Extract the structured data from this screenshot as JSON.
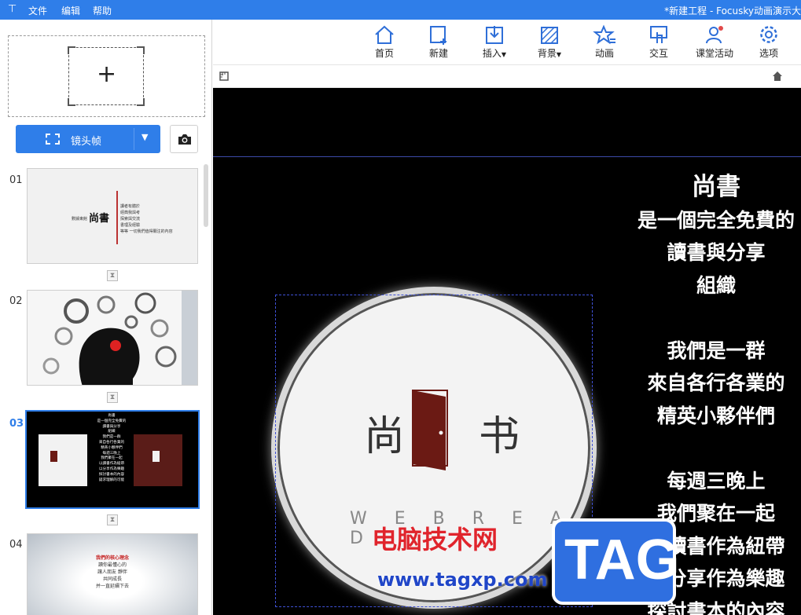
{
  "titlebar": {
    "pin_icon": "pin-icon",
    "menu": [
      "文件",
      "编辑",
      "帮助"
    ],
    "window_title": "*新建工程 - Focusky动画演示大"
  },
  "sidebar": {
    "lens_button_label": "镜头帧",
    "slides": [
      {
        "num": "01",
        "lines": [
          "尚書",
          "數據東館",
          "讀者有體於",
          "經典我與考",
          "探索與交流",
          "書理及經驗",
          "等等 一切我們值得關注的內容"
        ]
      },
      {
        "num": "02"
      },
      {
        "num": "03",
        "lines": [
          "尚書",
          "是一個完全免費的",
          "讀書與分享",
          "組織",
          "我們是一群",
          "來自各行各業的",
          "精英小夥伴們",
          "每週三晚上",
          "我們聚在一起",
          "以讀書作為紐帶",
          "以分享作為樂趣",
          "探討書本的內容",
          "疑求理解的可能"
        ]
      },
      {
        "num": "04",
        "lines": [
          "我們的核心理念",
          "讀你最懂心的",
          "讓人朋友 靜伴",
          "共同成長",
          "并一直延續下去"
        ]
      }
    ]
  },
  "toolbar": {
    "items": [
      {
        "label": "首页",
        "icon": "home-icon"
      },
      {
        "label": "新建",
        "icon": "new-slide-icon"
      },
      {
        "label": "插入",
        "icon": "insert-icon",
        "dropdown": true
      },
      {
        "label": "背景",
        "icon": "background-icon",
        "dropdown": true
      },
      {
        "label": "动画",
        "icon": "animation-icon"
      },
      {
        "label": "交互",
        "icon": "interaction-icon"
      },
      {
        "label": "课堂活动",
        "icon": "classroom-icon"
      },
      {
        "label": "选项",
        "icon": "settings-icon"
      }
    ]
  },
  "canvas": {
    "text_title": "尚書",
    "text_lines": [
      "是一個完全免費的",
      "讀書與分享",
      "組織",
      "",
      "我們是一群",
      "來自各行各業的",
      "精英小夥伴們",
      "",
      "每週三晚上",
      "我們聚在一起",
      "以讀書作為紐帶",
      "以分享作為樂趣",
      "探討書本的內容"
    ],
    "logo_left": "尚",
    "logo_right": "书",
    "logo_sub": "W E B R E A D"
  },
  "watermark": {
    "site_name": "电脑技术网",
    "url": "www.tagxp.com",
    "tag": "TAG"
  },
  "colors": {
    "accent": "#2f7ee9",
    "canvas_bg": "#000000",
    "door": "#6b1a14"
  }
}
